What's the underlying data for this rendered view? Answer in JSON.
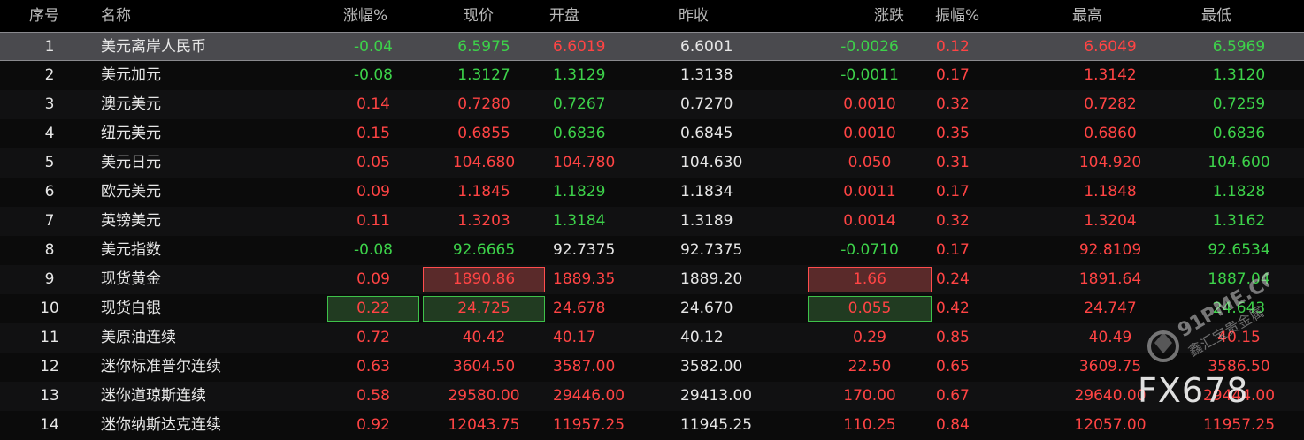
{
  "columns": [
    "序号",
    "名称",
    "涨幅%",
    "现价",
    "开盘",
    "昨收",
    "涨跌",
    "振幅%",
    "最高",
    "最低"
  ],
  "colors": {
    "up": "#ff4444",
    "down": "#3dd24a",
    "flat": "#e6e6e6"
  },
  "rows": [
    {
      "idx": "1",
      "name": "美元离岸人民币",
      "pct": "-0.04",
      "price": "6.5975",
      "open": "6.6019",
      "prev": "6.6001",
      "chg": "-0.0026",
      "amp": "0.12",
      "high": "6.6049",
      "low": "6.5969"
    },
    {
      "idx": "2",
      "name": "美元加元",
      "pct": "-0.08",
      "price": "1.3127",
      "open": "1.3129",
      "prev": "1.3138",
      "chg": "-0.0011",
      "amp": "0.17",
      "high": "1.3142",
      "low": "1.3120"
    },
    {
      "idx": "3",
      "name": "澳元美元",
      "pct": "0.14",
      "price": "0.7280",
      "open": "0.7267",
      "prev": "0.7270",
      "chg": "0.0010",
      "amp": "0.32",
      "high": "0.7282",
      "low": "0.7259"
    },
    {
      "idx": "4",
      "name": "纽元美元",
      "pct": "0.15",
      "price": "0.6855",
      "open": "0.6836",
      "prev": "0.6845",
      "chg": "0.0010",
      "amp": "0.35",
      "high": "0.6860",
      "low": "0.6836"
    },
    {
      "idx": "5",
      "name": "美元日元",
      "pct": "0.05",
      "price": "104.680",
      "open": "104.780",
      "prev": "104.630",
      "chg": "0.050",
      "amp": "0.31",
      "high": "104.920",
      "low": "104.600"
    },
    {
      "idx": "6",
      "name": "欧元美元",
      "pct": "0.09",
      "price": "1.1845",
      "open": "1.1829",
      "prev": "1.1834",
      "chg": "0.0011",
      "amp": "0.17",
      "high": "1.1848",
      "low": "1.1828"
    },
    {
      "idx": "7",
      "name": "英镑美元",
      "pct": "0.11",
      "price": "1.3203",
      "open": "1.3184",
      "prev": "1.3189",
      "chg": "0.0014",
      "amp": "0.32",
      "high": "1.3204",
      "low": "1.3162"
    },
    {
      "idx": "8",
      "name": "美元指数",
      "pct": "-0.08",
      "price": "92.6665",
      "open": "92.7375",
      "prev": "92.7375",
      "chg": "-0.0710",
      "amp": "0.17",
      "high": "92.8109",
      "low": "92.6534"
    },
    {
      "idx": "9",
      "name": "现货黄金",
      "pct": "0.09",
      "price": "1890.86",
      "open": "1889.35",
      "prev": "1889.20",
      "chg": "1.66",
      "amp": "0.24",
      "high": "1891.64",
      "low": "1887.04"
    },
    {
      "idx": "10",
      "name": "现货白银",
      "pct": "0.22",
      "price": "24.725",
      "open": "24.678",
      "prev": "24.670",
      "chg": "0.055",
      "amp": "0.42",
      "high": "24.747",
      "low": "24.643"
    },
    {
      "idx": "11",
      "name": "美原油连续",
      "pct": "0.72",
      "price": "40.42",
      "open": "40.17",
      "prev": "40.12",
      "chg": "0.29",
      "amp": "0.85",
      "high": "40.49",
      "low": "40.15"
    },
    {
      "idx": "12",
      "name": "迷你标准普尔连续",
      "pct": "0.63",
      "price": "3604.50",
      "open": "3587.00",
      "prev": "3582.00",
      "chg": "22.50",
      "amp": "0.65",
      "high": "3609.75",
      "low": "3586.50"
    },
    {
      "idx": "13",
      "name": "迷你道琼斯连续",
      "pct": "0.58",
      "price": "29580.00",
      "open": "29446.00",
      "prev": "29413.00",
      "chg": "170.00",
      "amp": "0.67",
      "high": "29640.00",
      "low": "29444.00"
    },
    {
      "idx": "14",
      "name": "迷你纳斯达克连续",
      "pct": "0.92",
      "price": "12043.75",
      "open": "11957.25",
      "prev": "11945.25",
      "chg": "110.25",
      "amp": "0.84",
      "high": "12057.00",
      "low": "11957.25"
    }
  ],
  "selected_row": "1",
  "watermark": {
    "site": "91PME.COM",
    "slogan": "鑫汇宝贵金属",
    "brand": "FX678"
  }
}
